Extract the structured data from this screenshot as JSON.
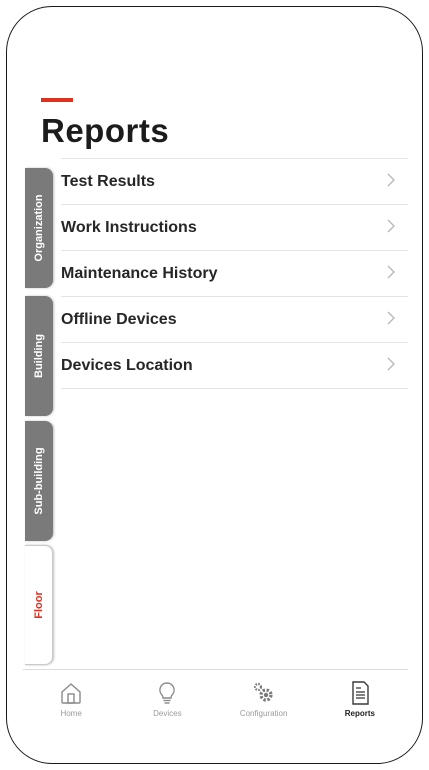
{
  "page": {
    "title": "Reports",
    "accent_color": "#e03020"
  },
  "side_tabs": [
    {
      "label": "Organization",
      "active": false
    },
    {
      "label": "Building",
      "active": false
    },
    {
      "label": "Sub-building",
      "active": false
    },
    {
      "label": "Floor",
      "active": true
    }
  ],
  "menu": [
    {
      "label": "Test Results",
      "icon": "chevron-right-icon"
    },
    {
      "label": "Work Instructions",
      "icon": "chevron-right-icon"
    },
    {
      "label": "Maintenance History",
      "icon": "chevron-right-icon"
    },
    {
      "label": "Offline Devices",
      "icon": "chevron-right-icon"
    },
    {
      "label": "Devices Location",
      "icon": "chevron-right-icon"
    }
  ],
  "bottom_nav": [
    {
      "label": "Home",
      "icon": "home-icon",
      "active": false
    },
    {
      "label": "Devices",
      "icon": "lightbulb-icon",
      "active": false
    },
    {
      "label": "Configuration",
      "icon": "gears-icon",
      "active": false
    },
    {
      "label": "Reports",
      "icon": "document-icon",
      "active": true
    }
  ]
}
